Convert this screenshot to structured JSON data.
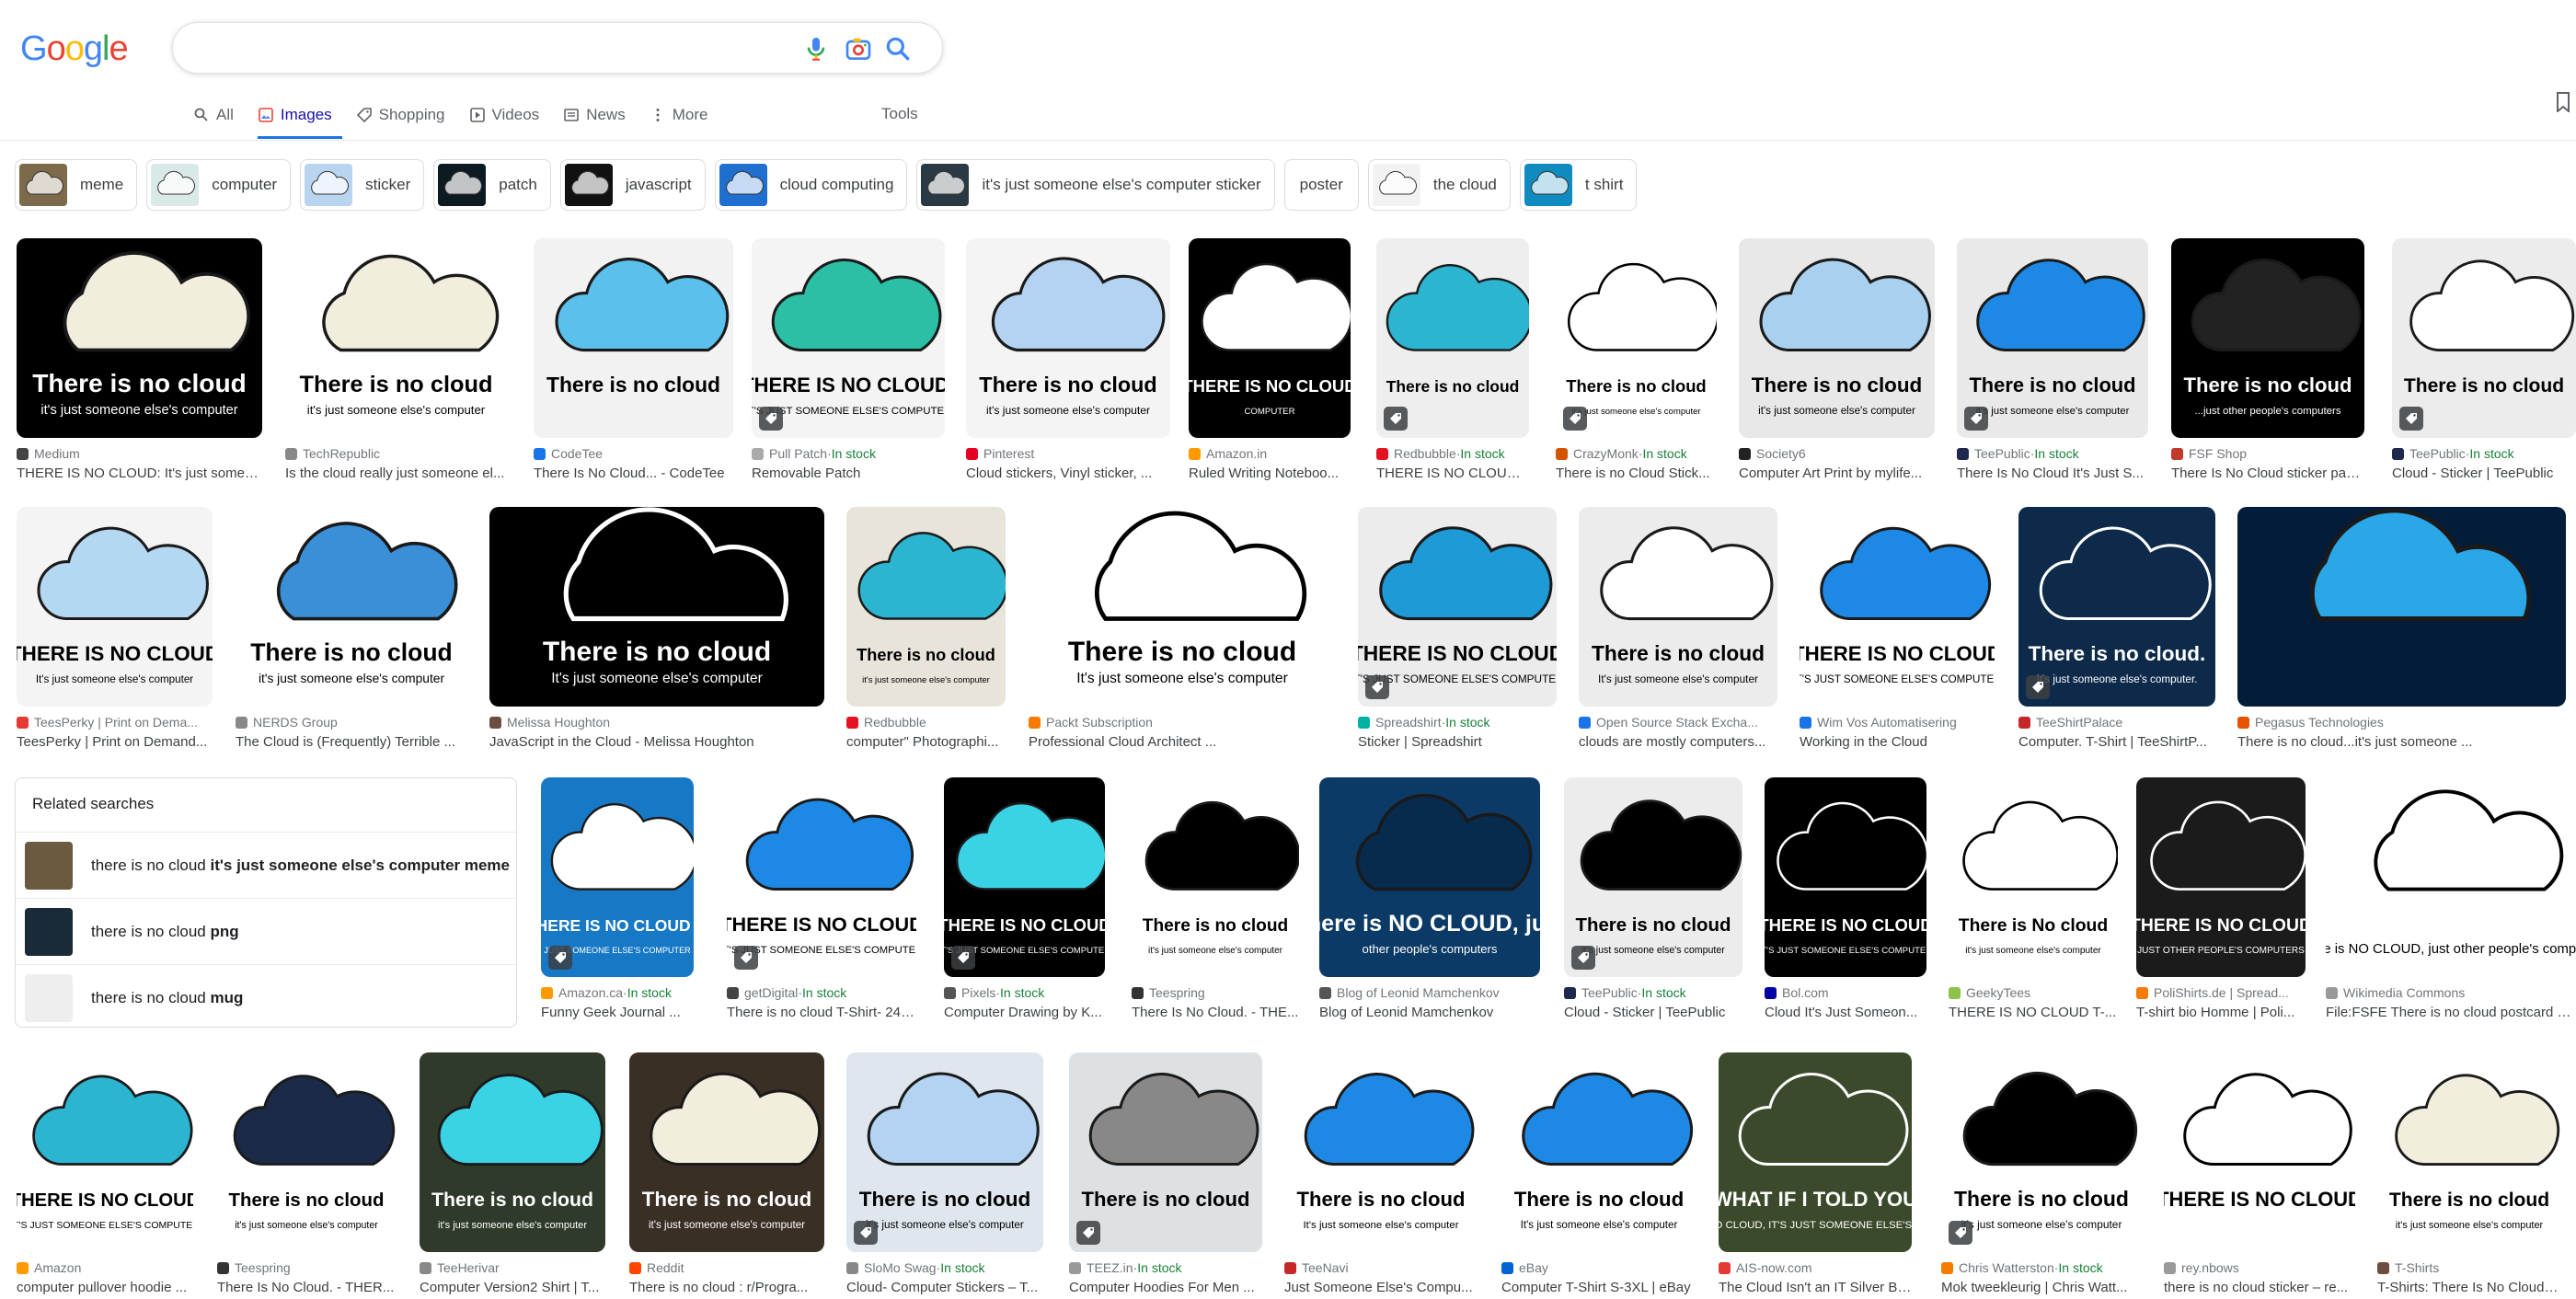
{
  "header": {
    "logo": [
      "G",
      "o",
      "o",
      "g",
      "l",
      "e"
    ],
    "logo_colors": [
      "#4285F4",
      "#EA4335",
      "#FBBC05",
      "#4285F4",
      "#34A853",
      "#EA4335"
    ],
    "search_value": ""
  },
  "tabs": [
    {
      "label": "All",
      "icon": "search-icon"
    },
    {
      "label": "Images",
      "icon": "image-icon",
      "active": true
    },
    {
      "label": "Shopping",
      "icon": "tag-icon"
    },
    {
      "label": "Videos",
      "icon": "play-icon"
    },
    {
      "label": "News",
      "icon": "news-icon"
    },
    {
      "label": "More",
      "icon": "more-vert-icon"
    }
  ],
  "tools_label": "Tools",
  "chips": [
    {
      "label": "meme",
      "thumb": "#7c6a4a"
    },
    {
      "label": "computer",
      "thumb": "#d9e9e8"
    },
    {
      "label": "sticker",
      "thumb": "#b9d4ee"
    },
    {
      "label": "patch",
      "thumb": "#0e1a22"
    },
    {
      "label": "javascript",
      "thumb": "#111111"
    },
    {
      "label": "cloud computing",
      "thumb": "#1e6fcf"
    },
    {
      "label": "it's just someone else's computer sticker",
      "thumb": "#2a3a44"
    },
    {
      "label": "poster",
      "thumb": null
    },
    {
      "label": "the cloud",
      "thumb": "#f2f2f2"
    },
    {
      "label": "t shirt",
      "thumb": "#0f8bbf"
    }
  ],
  "row1": [
    {
      "source": "Medium",
      "stock": "",
      "title": "THERE IS NO CLOUD: It's just someo...",
      "bg": "#000000",
      "cloud": "#f2eede",
      "text": "There is no cloud",
      "sub": "it's just someone else's computer",
      "fav": "#444",
      "badge": false
    },
    {
      "source": "TechRepublic",
      "stock": "",
      "title": "Is the cloud really just someone el...",
      "bg": "#ffffff",
      "cloud": "#f2eede",
      "text": "There is no cloud",
      "sub": "it's just someone else's computer",
      "fav": "#888",
      "badge": false
    },
    {
      "source": "CodeTee",
      "stock": "",
      "title": "There Is No Cloud... - CodeTee",
      "bg": "#f2f2f2",
      "cloud": "#5bc0eb",
      "text": "There is no cloud",
      "sub": "",
      "fav": "#1a73e8",
      "badge": false
    },
    {
      "source": "Pull Patch",
      "stock": "In stock",
      "title": "Removable Patch",
      "bg": "#f4f4f4",
      "cloud": "#2bbfa5",
      "text": "THERE IS NO CLOUD.",
      "sub": "IT'S JUST SOMEONE ELSE'S COMPUTER",
      "fav": "#aaa",
      "badge": true
    },
    {
      "source": "Pinterest",
      "stock": "",
      "title": "Cloud stickers, Vinyl sticker, ...",
      "bg": "#f4f4f4",
      "cloud": "#b4d3f2",
      "text": "There is no cloud",
      "sub": "it's just someone else's computer",
      "fav": "#e60023",
      "badge": false
    },
    {
      "source": "Amazon.in",
      "stock": "",
      "title": "Ruled Writing Noteboo...",
      "bg": "#000000",
      "cloud": "#ffffff",
      "text": "THERE IS NO CLOUD",
      "sub": "COMPUTER",
      "fav": "#ff9900",
      "badge": false
    },
    {
      "source": "Redbubble",
      "stock": "In stock",
      "title": "THERE IS NO CLOUD, It'...",
      "bg": "#eeeeee",
      "cloud": "#2bb5d1",
      "text": "There is no cloud",
      "sub": "",
      "fav": "#e41321",
      "badge": true
    },
    {
      "source": "CrazyMonk",
      "stock": "In stock",
      "title": "There is no Cloud Stick...",
      "bg": "#ffffff",
      "cloud": "#ffffff",
      "text": "There is no cloud",
      "sub": "it's just someone else's computer",
      "fav": "#d35400",
      "badge": true
    },
    {
      "source": "Society6",
      "stock": "",
      "title": "Computer Art Print by mylife...",
      "bg": "#e8e8e8",
      "cloud": "#a9d0ef",
      "text": "There is no cloud",
      "sub": "it's just someone else's computer",
      "fav": "#222",
      "badge": false
    },
    {
      "source": "TeePublic",
      "stock": "In stock",
      "title": "There Is No Cloud It's Just S...",
      "bg": "#e9e9e9",
      "cloud": "#1e88e5",
      "text": "There is no cloud",
      "sub": "it's just someone else's computer",
      "fav": "#1d2a4d",
      "badge": true
    },
    {
      "source": "FSF Shop",
      "stock": "",
      "title": "There Is No Cloud sticker pac...",
      "bg": "#000000",
      "cloud": "#222222",
      "text": "There is no cloud",
      "sub": "...just other people's computers",
      "fav": "#c0392b",
      "badge": false
    },
    {
      "source": "TeePublic",
      "stock": "In stock",
      "title": "Cloud - Sticker | TeePublic",
      "bg": "#ececec",
      "cloud": "#ffffff",
      "text": "There is no cloud",
      "sub": "",
      "fav": "#1d2a4d",
      "badge": true
    }
  ],
  "row2": [
    {
      "source": "TeesPerky | Print on Dema...",
      "stock": "",
      "title": "TeesPerky | Print on Demand...",
      "bg": "#f4f4f4",
      "cloud": "#b4d7f2",
      "text": "THERE IS NO CLOUD",
      "sub": "It's just someone else's computer",
      "fav": "#e53935",
      "badge": false
    },
    {
      "source": "NERDS Group",
      "stock": "",
      "title": "The Cloud is (Frequently) Terrible ...",
      "bg": "#ffffff",
      "cloud": "#3b8fd6",
      "text": "There is no cloud",
      "sub": "it's just someone else's computer",
      "fav": "#888",
      "badge": false
    },
    {
      "source": "Melissa Houghton",
      "stock": "",
      "title": "JavaScript in the Cloud - Melissa Houghton",
      "bg": "#000000",
      "cloud": "#000000",
      "text": "There is no cloud",
      "sub": "It's just someone else's computer",
      "fav": "#6d4c41",
      "badge": false
    },
    {
      "source": "Redbubble",
      "stock": "",
      "title": "computer\" Photographi...",
      "bg": "#e8e4da",
      "cloud": "#2bb5d1",
      "text": "There is no cloud",
      "sub": "it's just someone else's computer",
      "fav": "#e41321",
      "badge": false
    },
    {
      "source": "Packt Subscription",
      "stock": "",
      "title": "Professional Cloud Architect ...",
      "bg": "#ffffff",
      "cloud": "#ffffff",
      "text": "There is no cloud",
      "sub": "It's just someone else's computer",
      "fav": "#f57c00",
      "badge": false
    },
    {
      "source": "Spreadshirt",
      "stock": "In stock",
      "title": "Sticker | Spreadshirt",
      "bg": "#ececec",
      "cloud": "#1e9ad6",
      "text": "THERE IS NO CLOUD",
      "sub": "IT'S JUST SOMEONE ELSE'S COMPUTER",
      "fav": "#00b2a5",
      "badge": true
    },
    {
      "source": "Open Source Stack Excha...",
      "stock": "",
      "title": "clouds are mostly computers...",
      "bg": "#ececec",
      "cloud": "#ffffff",
      "text": "There is no cloud",
      "sub": "It's just someone else's computer",
      "fav": "#1a73e8",
      "badge": false
    },
    {
      "source": "Wim Vos Automatisering",
      "stock": "",
      "title": "Working in the Cloud",
      "bg": "#ffffff",
      "cloud": "#1e88e5",
      "text": "THERE IS NO CLOUD",
      "sub": "IT'S JUST SOMEONE ELSE'S COMPUTER",
      "fav": "#1a73e8",
      "badge": false
    },
    {
      "source": "TeeShirtPalace",
      "stock": "",
      "title": "Computer. T-Shirt | TeeShirtP...",
      "bg": "#0d2a4a",
      "cloud": "#0d2a4a",
      "text": "There is no cloud.",
      "sub": "It's just someone else's computer.",
      "fav": "#c62828",
      "badge": true
    },
    {
      "source": "Pegasus Technologies",
      "stock": "",
      "title": "There is no cloud...it's just someone ...",
      "bg": "#031c3a",
      "cloud": "#2aa7e6",
      "text": "",
      "sub": "",
      "fav": "#e65100",
      "badge": false
    }
  ],
  "related": {
    "heading": "Related searches",
    "items": [
      {
        "prefix": "there is no cloud ",
        "bold": "it's just someone else's computer meme",
        "thumb": "#6b5a3f"
      },
      {
        "prefix": "there is no cloud ",
        "bold": "png",
        "thumb": "#1b2a38"
      },
      {
        "prefix": "there is no cloud ",
        "bold": "mug",
        "thumb": "#eeeeee"
      }
    ]
  },
  "row3": [
    {
      "source": "Amazon.ca",
      "stock": "In stock",
      "title": "Funny Geek Journal ...",
      "bg": "#1778c6",
      "cloud": "#ffffff",
      "text": "THERE IS NO CLOUD ...",
      "sub": "JUST SOMEONE ELSE'S COMPUTER",
      "fav": "#ff9900",
      "badge": true
    },
    {
      "source": "getDigital",
      "stock": "In stock",
      "title": "There is no cloud T-Shirt- 24 u...",
      "bg": "#ffffff",
      "cloud": "#1e88e5",
      "text": "THERE IS NO CLOUD",
      "sub": "IT'S JUST SOMEONE ELSE'S COMPUTER",
      "fav": "#444",
      "badge": true
    },
    {
      "source": "Pixels",
      "stock": "In stock",
      "title": "Computer Drawing by K...",
      "bg": "#000000",
      "cloud": "#3ad3e6",
      "text": "THERE IS NO CLOUD",
      "sub": "IT'S JUST SOMEONE ELSE'S COMPUTER",
      "fav": "#555",
      "badge": true
    },
    {
      "source": "Teespring",
      "stock": "",
      "title": "There Is No Cloud. - THE...",
      "bg": "#ffffff",
      "cloud": "#000000",
      "text": "There is no cloud",
      "sub": "it's just someone else's computer",
      "fav": "#333",
      "badge": false
    },
    {
      "source": "Blog of Leonid Mamchenkov",
      "stock": "",
      "title": "Blog of Leonid Mamchenkov",
      "bg": "#0b3a66",
      "cloud": "#082a4c",
      "text": "There is NO CLOUD, just",
      "sub": "other people's computers",
      "fav": "#555",
      "badge": false
    },
    {
      "source": "TeePublic",
      "stock": "In stock",
      "title": "Cloud - Sticker | TeePublic",
      "bg": "#ececec",
      "cloud": "#000000",
      "text": "There is no cloud",
      "sub": "it's just someone else's computer",
      "fav": "#1d2a4d",
      "badge": true
    },
    {
      "source": "Bol.com",
      "stock": "",
      "title": "Cloud It's Just Someon...",
      "bg": "#000000",
      "cloud": "#000000",
      "text": "THERE IS NO CLOUD",
      "sub": "IT'S JUST SOMEONE ELSE'S COMPUTER",
      "fav": "#0000a4",
      "badge": false
    },
    {
      "source": "GeekyTees",
      "stock": "",
      "title": "THERE IS NO CLOUD T-...",
      "bg": "#ffffff",
      "cloud": "#ffffff",
      "text": "There is No cloud",
      "sub": "it's just someone else's computer",
      "fav": "#8bc34a",
      "badge": false
    },
    {
      "source": "PoliShirts.de | Spread...",
      "stock": "",
      "title": "T-shirt bio Homme | Poli...",
      "bg": "#1b1b1b",
      "cloud": "#1b1b1b",
      "text": "THERE IS NO CLOUD",
      "sub": "JUST OTHER PEOPLE'S COMPUTERS",
      "fav": "#f57c00",
      "badge": false
    },
    {
      "source": "Wikimedia Commons",
      "stock": "",
      "title": "File:FSFE There is no cloud postcard en ...",
      "bg": "#ffffff",
      "cloud": "#ffffff",
      "text": "",
      "sub": "There is NO CLOUD, just other people's computers",
      "fav": "#999",
      "badge": false
    }
  ],
  "row4": [
    {
      "source": "Amazon",
      "stock": "",
      "title": "computer pullover hoodie ...",
      "bg": "#ffffff",
      "cloud": "#2bb5d1",
      "text": "THERE IS NO CLOUD",
      "sub": "IT'S JUST SOMEONE ELSE'S COMPUTER",
      "fav": "#ff9900",
      "badge": false
    },
    {
      "source": "Teespring",
      "stock": "",
      "title": "There Is No Cloud. - THER...",
      "bg": "#ffffff",
      "cloud": "#1a2a48",
      "text": "There is no cloud",
      "sub": "it's just someone else's computer",
      "fav": "#333",
      "badge": false
    },
    {
      "source": "TeeHerivar",
      "stock": "",
      "title": "Computer Version2 Shirt | T...",
      "bg": "#2f3a2a",
      "cloud": "#3ad3e6",
      "text": "There is no cloud",
      "sub": "it's just someone else's computer",
      "fav": "#888",
      "badge": false
    },
    {
      "source": "Reddit",
      "stock": "",
      "title": "There is no cloud : r/Progra...",
      "bg": "#3a2f25",
      "cloud": "#f2eede",
      "text": "There is no cloud",
      "sub": "it's just someone else's computer",
      "fav": "#ff4500",
      "badge": false
    },
    {
      "source": "SloMo Swag",
      "stock": "In stock",
      "title": "Cloud- Computer Stickers – T...",
      "bg": "#dfe6ee",
      "cloud": "#b4d3f2",
      "text": "There is no cloud",
      "sub": "it's just someone else's computer",
      "fav": "#888",
      "badge": true
    },
    {
      "source": "TEEZ.in",
      "stock": "In stock",
      "title": "Computer Hoodies For Men ...",
      "bg": "#dde1e4",
      "cloud": "#888888",
      "text": "There is no cloud",
      "sub": "",
      "fav": "#999",
      "badge": true
    },
    {
      "source": "TeeNavi",
      "stock": "",
      "title": "Just Someone Else's Compu...",
      "bg": "#ffffff",
      "cloud": "#1e88e5",
      "text": "There is no cloud",
      "sub": "It's just someone else's computer",
      "fav": "#c62828",
      "badge": false
    },
    {
      "source": "eBay",
      "stock": "",
      "title": "Computer T-Shirt S-3XL | eBay",
      "bg": "#ffffff",
      "cloud": "#1e88e5",
      "text": "There is no cloud",
      "sub": "It's just someone else's computer",
      "fav": "#0064d2",
      "badge": false
    },
    {
      "source": "AIS-now.com",
      "stock": "",
      "title": "The Cloud Isn't an IT Silver Bu...",
      "bg": "#3b4a2a",
      "cloud": "#3b4a2a",
      "text": "WHAT IF I TOLD YOU",
      "sub": "THERE IS NO CLOUD, IT'S JUST SOMEONE ELSE'S COMPUTER",
      "fav": "#e53935",
      "badge": false
    },
    {
      "source": "Chris Watterston",
      "stock": "In stock",
      "title": "Mok tweekleurig | Chris Watt...",
      "bg": "#ffffff",
      "cloud": "#000000",
      "text": "There is no cloud",
      "sub": "it's just someone else's computer",
      "fav": "#f57c00",
      "badge": true
    },
    {
      "source": "rey.nbows",
      "stock": "",
      "title": "there is no cloud sticker – re...",
      "bg": "#ffffff",
      "cloud": "#ffffff",
      "text": "THERE IS NO CLOUD",
      "sub": "",
      "fav": "#999",
      "badge": false
    },
    {
      "source": "T-Shirts",
      "stock": "",
      "title": "T-Shirts: There Is No Cloud I...",
      "bg": "#ffffff",
      "cloud": "#f2eede",
      "text": "There is no cloud",
      "sub": "it's just someone else's computer",
      "fav": "#6d4c41",
      "badge": false
    }
  ]
}
